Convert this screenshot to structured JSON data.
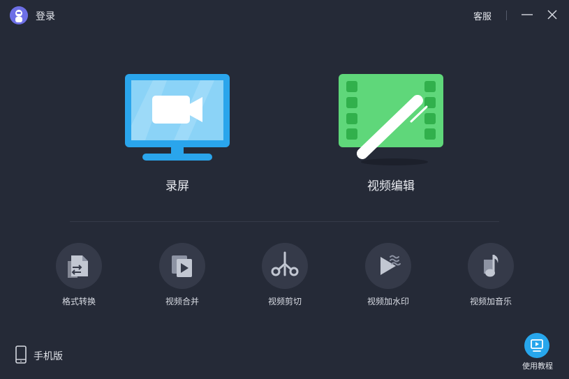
{
  "titlebar": {
    "login_label": "登录",
    "service_label": "客服"
  },
  "features": [
    {
      "label": "录屏",
      "icon": "monitor-camera-icon",
      "color": "#2aa5ec"
    },
    {
      "label": "视频编辑",
      "icon": "film-pen-icon",
      "color": "#5fd77a"
    }
  ],
  "tools": [
    {
      "label": "格式转换",
      "icon": "format-convert-icon"
    },
    {
      "label": "视频合并",
      "icon": "video-merge-icon"
    },
    {
      "label": "视频剪切",
      "icon": "scissors-icon"
    },
    {
      "label": "视频加水印",
      "icon": "watermark-icon"
    },
    {
      "label": "视频加音乐",
      "icon": "music-note-icon"
    }
  ],
  "footer": {
    "mobile_label": "手机版",
    "tutorial_label": "使用教程"
  }
}
